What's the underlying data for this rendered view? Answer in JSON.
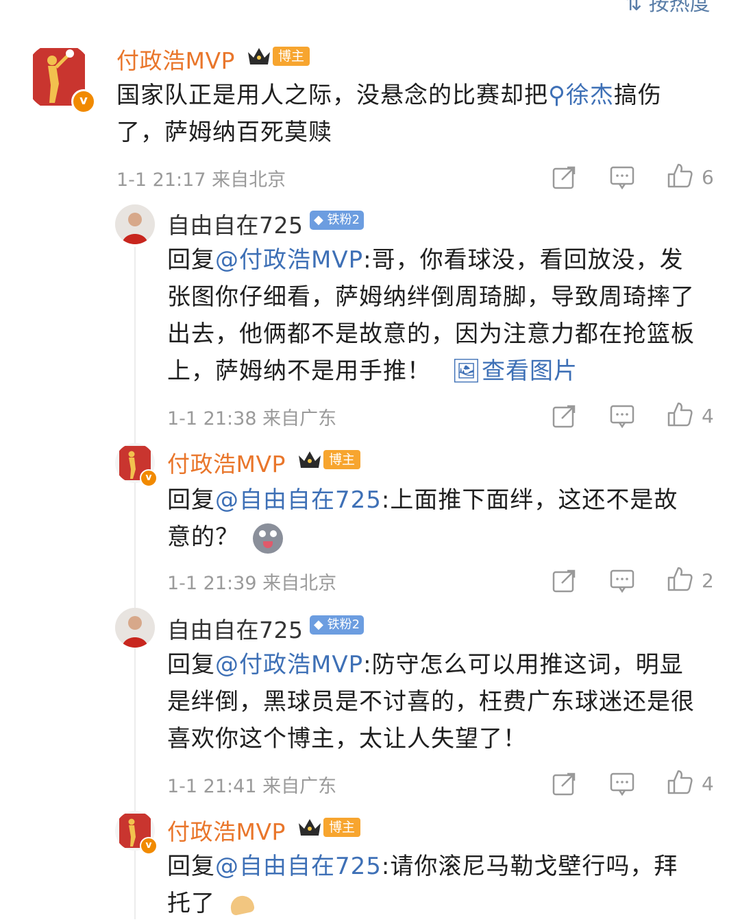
{
  "sort_label": "按热度",
  "main_comment": {
    "username": "付政浩MVP",
    "badge": "博主",
    "text_before": "国家队正是用人之际，没悬念的比赛却把",
    "topic_link": "徐杰",
    "text_after_line1": "搞伤",
    "text_line2": "了，萨姆纳百死莫赎",
    "meta": "1-1 21:17  来自北京",
    "likes": "6"
  },
  "replies": [
    {
      "username": "自由自在725",
      "badge": "铁粉2",
      "reply_prefix": "回复",
      "mention": "@付政浩MVP",
      "lines": [
        ":哥，你看球没，看回放没，发",
        "张图你仔细看，萨姆纳绊倒周琦脚，导致周琦摔了",
        "出去，他俩都不是故意的，因为注意力都在抢篮板",
        "上，萨姆纳不是用手推！"
      ],
      "view_image": "查看图片",
      "meta": "1-1 21:38  来自广东",
      "likes": "4"
    },
    {
      "username": "付政浩MVP",
      "badge": "博主",
      "reply_prefix": "回复",
      "mention": "@自由自在725",
      "lines": [
        ":上面推下面绊，这还不是故",
        "意的？"
      ],
      "meta": "1-1 21:39  来自北京",
      "likes": "2"
    },
    {
      "username": "自由自在725",
      "badge": "铁粉2",
      "reply_prefix": "回复",
      "mention": "@付政浩MVP",
      "lines": [
        ":防守怎么可以用推这词，明显",
        "是绊倒，黑球员是不讨喜的，枉费广东球迷还是很",
        "喜欢你这个博主，太让人失望了！"
      ],
      "meta": "1-1 21:41  来自广东",
      "likes": "4"
    },
    {
      "username": "付政浩MVP",
      "badge": "博主",
      "reply_prefix": "回复",
      "mention": "@自由自在725",
      "lines": [
        ":请你滚尼马勒戈壁行吗，拜",
        "托了"
      ]
    }
  ],
  "icons": {
    "share": "share-icon",
    "comment": "comment-icon",
    "like": "like-icon",
    "search": "search-icon",
    "image": "image-icon"
  },
  "colors": {
    "mvp_name": "#e9762b",
    "link": "#3e70b6",
    "meta": "#9a9a9a",
    "bozhu_tag": "#f7a52f",
    "fan_tag": "#6c9de0"
  }
}
